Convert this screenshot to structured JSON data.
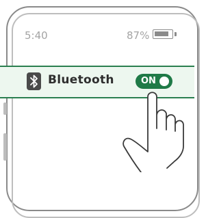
{
  "status_bar": {
    "time": "5:40",
    "battery_percent": "87%",
    "battery_level": 0.87
  },
  "setting": {
    "label": "Bluetooth",
    "icon": "bluetooth-icon",
    "toggle_text": "ON",
    "toggle_state": true
  },
  "colors": {
    "accent": "#1f7a47",
    "row_highlight": "#edf7ef",
    "row_border": "#2a7f4f"
  },
  "illustration": {
    "pointer": "hand-pointer-icon"
  }
}
